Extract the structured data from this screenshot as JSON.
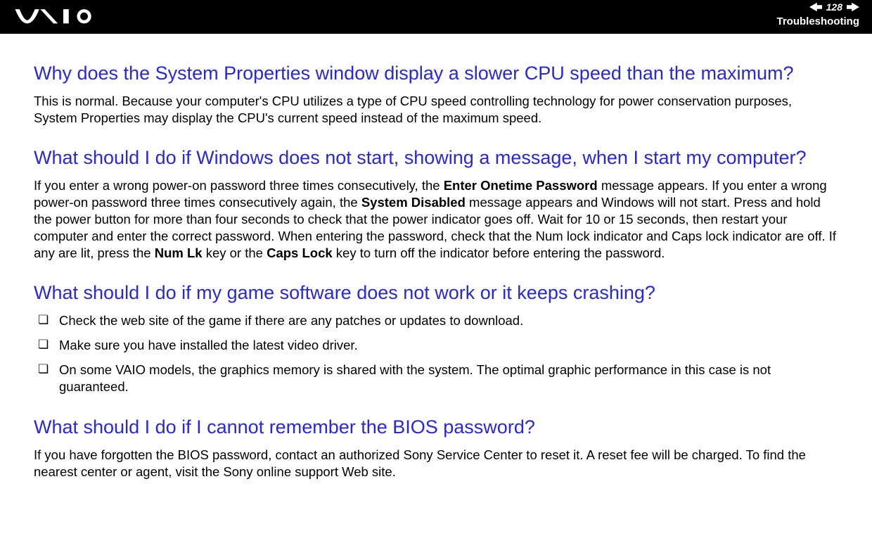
{
  "header": {
    "page_number": "128",
    "section": "Troubleshooting"
  },
  "content": {
    "q1": {
      "heading": "Why does the System Properties window display a slower CPU speed than the maximum?",
      "body": "This is normal. Because your computer's CPU utilizes a type of CPU speed controlling technology for power conservation purposes, System Properties may display the CPU's current speed instead of the maximum speed."
    },
    "q2": {
      "heading": "What should I do if Windows does not start, showing a message, when I start my computer?",
      "body_parts": {
        "a": "If you enter a wrong power-on password three times consecutively, the ",
        "b": "Enter Onetime Password",
        "c": " message appears. If you enter a wrong power-on password three times consecutively again, the ",
        "d": "System Disabled",
        "e": " message appears and Windows will not start. Press and hold the power button for more than four seconds to check that the power indicator goes off. Wait for 10 or 15 seconds, then restart your computer and enter the correct password. When entering the password, check that the Num lock indicator and Caps lock indicator are off. If any are lit, press the ",
        "f": "Num Lk",
        "g": " key or the ",
        "h": "Caps Lock",
        "i": " key to turn off the indicator before entering the password."
      }
    },
    "q3": {
      "heading": "What should I do if my game software does not work or it keeps crashing?",
      "bullets": {
        "0": "Check the web site of the game if there are any patches or updates to download.",
        "1": "Make sure you have installed the latest video driver.",
        "2": "On some VAIO models, the graphics memory is shared with the system. The optimal graphic performance in this case is not guaranteed."
      }
    },
    "q4": {
      "heading": "What should I do if I cannot remember the BIOS password?",
      "body": "If you have forgotten the BIOS password, contact an authorized Sony Service Center to reset it. A reset fee will be charged. To find the nearest center or agent, visit the Sony online support Web site."
    }
  }
}
